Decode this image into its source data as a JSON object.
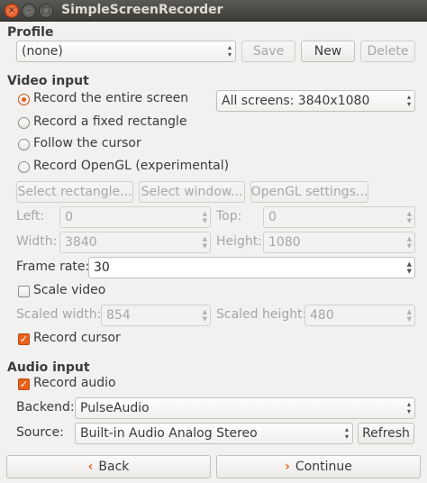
{
  "window": {
    "title": "SimpleScreenRecorder",
    "close_glyph": "×",
    "minimize_glyph": "–",
    "maximize_glyph": "□"
  },
  "profile": {
    "heading": "Profile",
    "selected": "(none)",
    "save_label": "Save",
    "new_label": "New",
    "delete_label": "Delete"
  },
  "video": {
    "heading": "Video input",
    "options": [
      "Record the entire screen",
      "Record a fixed rectangle",
      "Follow the cursor",
      "Record OpenGL (experimental)"
    ],
    "selected_option_index": 0,
    "screens_selected": "All screens: 3840x1080",
    "select_rectangle_label": "Select rectangle...",
    "select_window_label": "Select window...",
    "opengl_settings_label": "OpenGL settings...",
    "left_label": "Left:",
    "left_value": "0",
    "top_label": "Top:",
    "top_value": "0",
    "width_label": "Width:",
    "width_value": "3840",
    "height_label": "Height:",
    "height_value": "1080",
    "frame_rate_label": "Frame rate:",
    "frame_rate_value": "30",
    "scale_video_label": "Scale video",
    "scale_video_checked": false,
    "scaled_width_label": "Scaled width:",
    "scaled_width_value": "854",
    "scaled_height_label": "Scaled height:",
    "scaled_height_value": "480",
    "record_cursor_label": "Record cursor",
    "record_cursor_checked": true
  },
  "audio": {
    "heading": "Audio input",
    "record_audio_label": "Record audio",
    "record_audio_checked": true,
    "backend_label": "Backend:",
    "backend_value": "PulseAudio",
    "source_label": "Source:",
    "source_value": "Built-in Audio Analog Stereo",
    "refresh_label": "Refresh"
  },
  "nav": {
    "back_label": "Back",
    "continue_label": "Continue"
  },
  "colors": {
    "accent": "#e9611b",
    "titlebar": "#3d3c38",
    "background": "#f2f1f0"
  }
}
